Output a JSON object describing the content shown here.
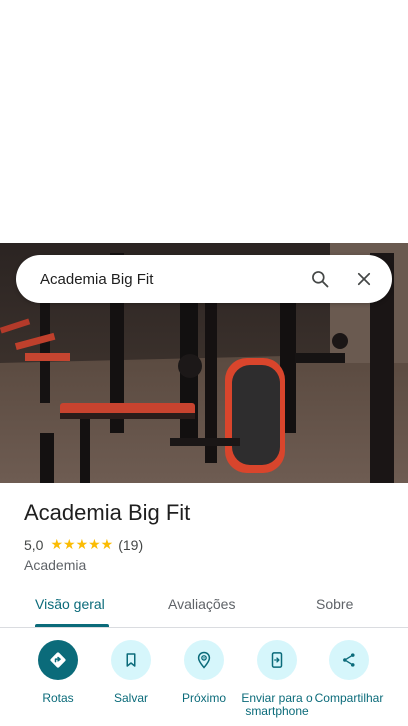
{
  "search": {
    "query": "Academia Big Fit"
  },
  "place": {
    "name": "Academia Big Fit",
    "rating": "5,0",
    "stars": "★★★★★",
    "review_count": "(19)",
    "category": "Academia"
  },
  "tabs": [
    {
      "label": "Visão geral",
      "active": true
    },
    {
      "label": "Avaliações",
      "active": false
    },
    {
      "label": "Sobre",
      "active": false
    }
  ],
  "actions": [
    {
      "label": "Rotas",
      "icon": "directions-icon"
    },
    {
      "label": "Salvar",
      "icon": "bookmark-icon"
    },
    {
      "label": "Próximo",
      "icon": "nearby-icon"
    },
    {
      "label": "Enviar para o smartphone",
      "icon": "send-to-phone-icon"
    },
    {
      "label": "Compartilhar",
      "icon": "share-icon"
    }
  ],
  "colors": {
    "accent": "#0b6b7a",
    "action_bg": "#d6f6fb",
    "star": "#fbbc04"
  }
}
